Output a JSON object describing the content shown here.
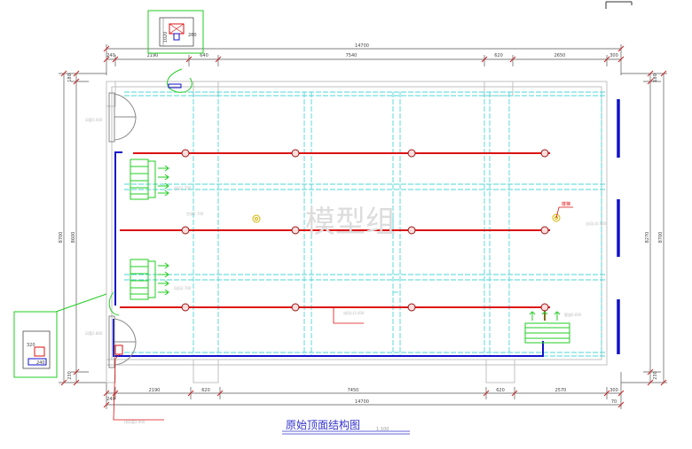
{
  "drawing": {
    "title": "原始顶面结构图",
    "scale": "1:100",
    "watermark": "模型组",
    "top_total": "14700",
    "bottom_total": "14700",
    "top_dims": [
      "240",
      "2190",
      "640",
      "7540",
      "620",
      "2650",
      "300"
    ],
    "bottom_dims": [
      "240",
      "2190",
      "620",
      "7450",
      "620",
      "2570",
      "300"
    ],
    "bottom_right_dims": [
      "300",
      "70"
    ],
    "left_outer_dim": "8700",
    "left_inner_dim": "8600",
    "left_top_dim": "180",
    "left_bottom_dim": "230",
    "right_dims": [
      "8700",
      "8270"
    ],
    "right_top_dim": "180",
    "right_bottom_dim": "230",
    "inset_top_dims": [
      "1020",
      "280"
    ],
    "inset_bottom_dims": [
      "320",
      "240"
    ],
    "red_label": "楼梯",
    "callouts": [
      "风管3.000",
      "空调2.700",
      "风机2.700",
      "风管2.800",
      "出风口0.600",
      "进风口3.000",
      "回风2.700",
      "管道0.600",
      "排风管2.900"
    ]
  },
  "colors": {
    "background": "#ffffff",
    "wall_grey": "#c0c0c0",
    "grid_cyan": "#4fd6d6",
    "pipe_red": "#dd1111",
    "pipe_blue": "#1111cc",
    "equipment_green": "#22cc22",
    "dimension_line": "#444444",
    "title_blue": "#3333cc"
  }
}
